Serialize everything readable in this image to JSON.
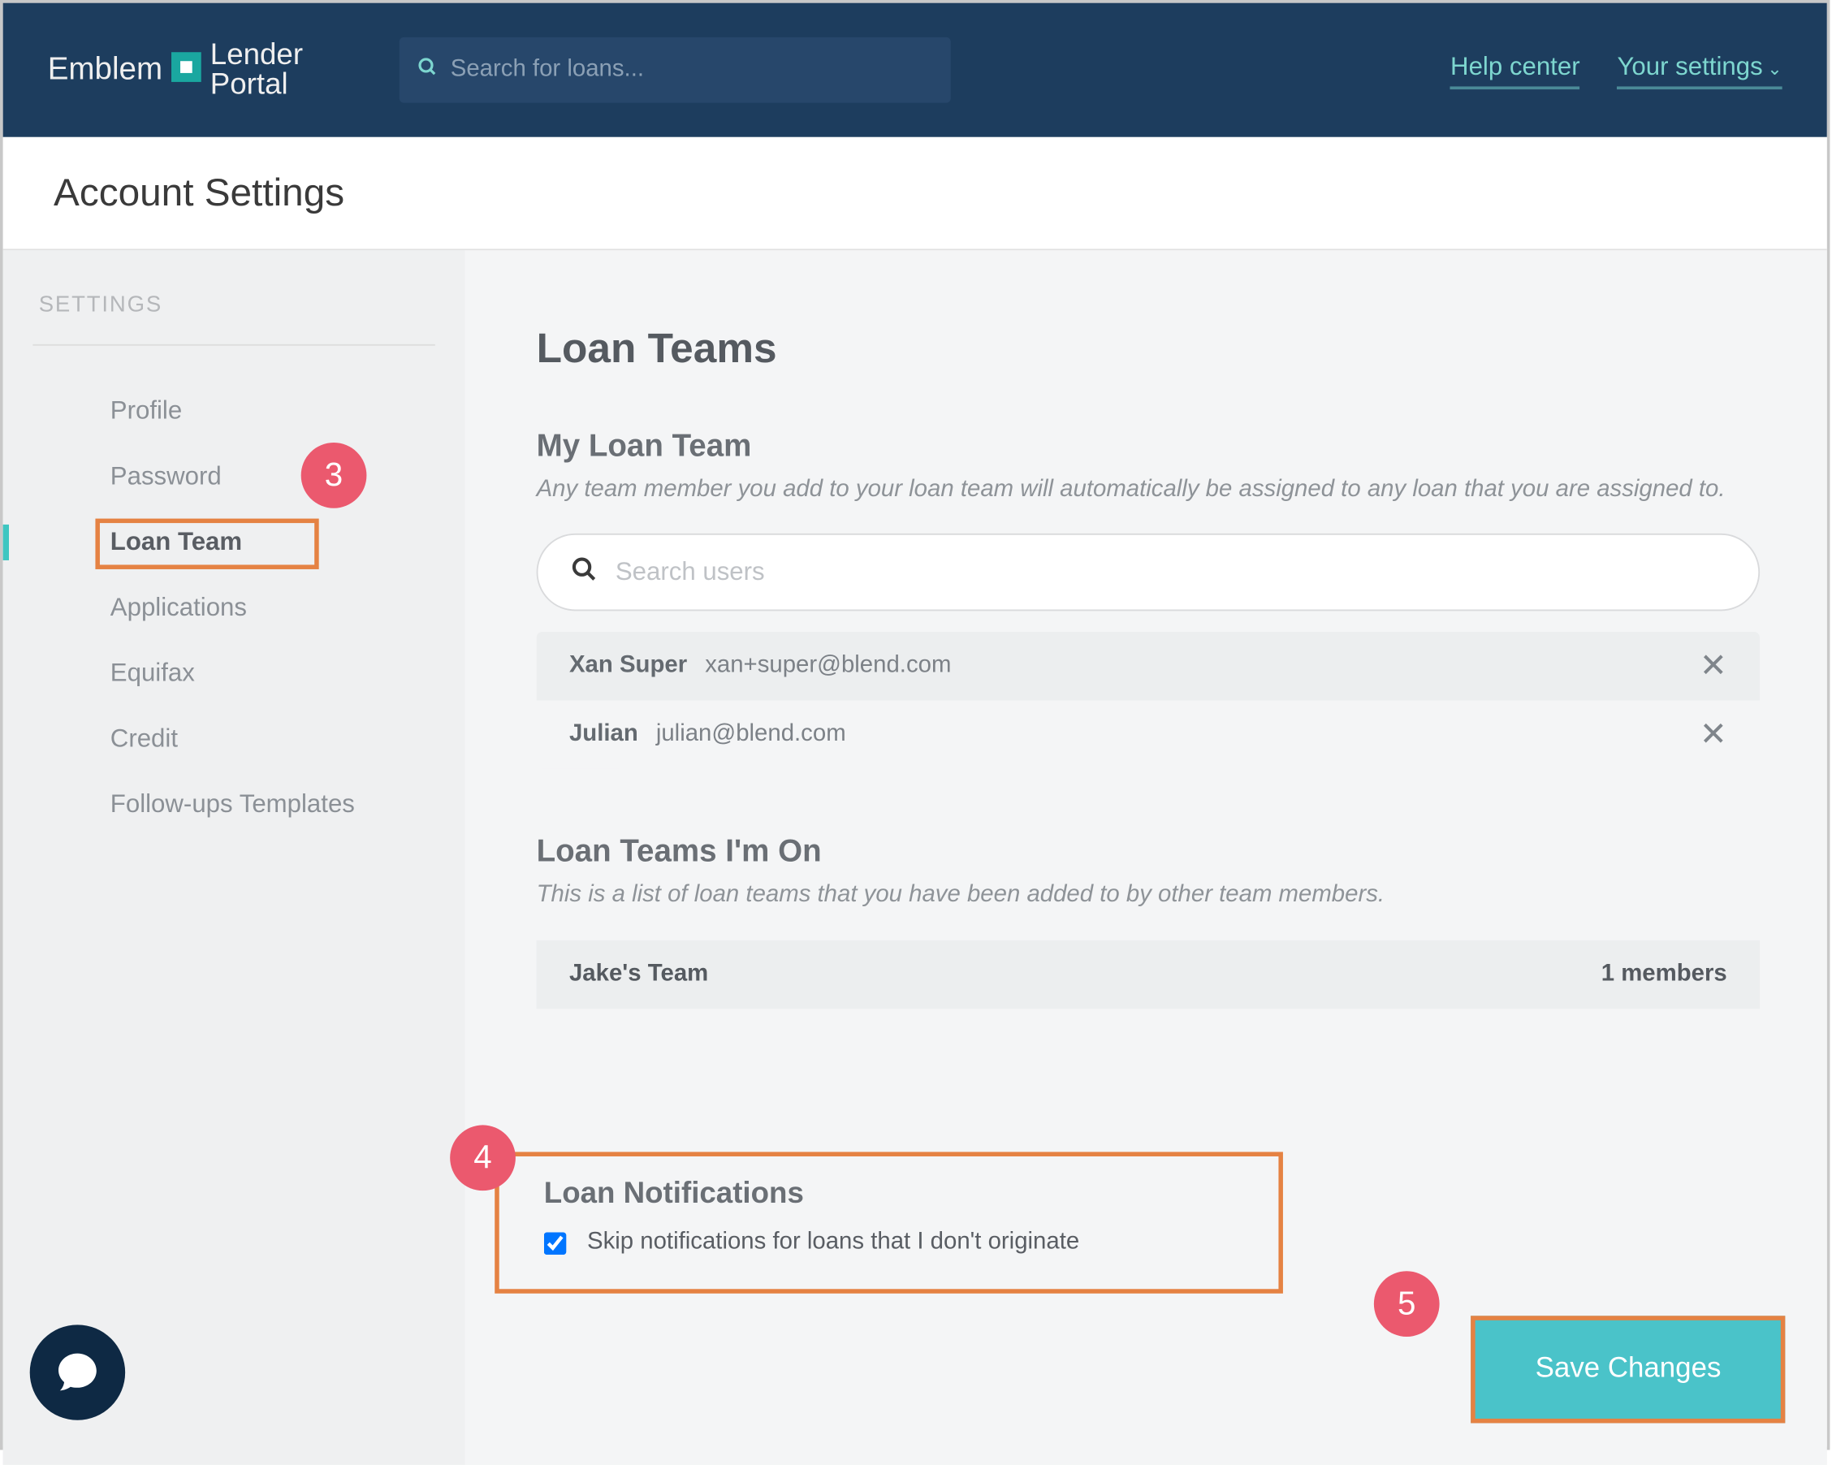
{
  "logo": {
    "brand": "Emblem",
    "line1": "Lender",
    "line2": "Portal"
  },
  "topbar": {
    "search_placeholder": "Search for loans...",
    "help_link": "Help center",
    "settings_link": "Your settings"
  },
  "page_title": "Account Settings",
  "sidebar": {
    "heading": "SETTINGS",
    "items": [
      {
        "label": "Profile"
      },
      {
        "label": "Password"
      },
      {
        "label": "Loan Team"
      },
      {
        "label": "Applications"
      },
      {
        "label": "Equifax"
      },
      {
        "label": "Credit"
      },
      {
        "label": "Follow-ups Templates"
      }
    ]
  },
  "main": {
    "title": "Loan Teams",
    "my_team": {
      "heading": "My Loan Team",
      "desc": "Any team member you add to your loan team will automatically be assigned to any loan that you are assigned to.",
      "search_placeholder": "Search users",
      "members": [
        {
          "name": "Xan Super",
          "email": "xan+super@blend.com"
        },
        {
          "name": "Julian",
          "email": "julian@blend.com"
        }
      ]
    },
    "on_teams": {
      "heading": "Loan Teams I'm On",
      "desc": "This is a list of loan teams that you have been added to by other team members.",
      "rows": [
        {
          "name": "Jake's Team",
          "count": "1 members"
        }
      ]
    },
    "notifications": {
      "heading": "Loan Notifications",
      "check_label": "Skip notifications for loans that I don't originate"
    },
    "save_button": "Save Changes"
  },
  "annotations": {
    "a3": "3",
    "a4": "4",
    "a5": "5"
  }
}
